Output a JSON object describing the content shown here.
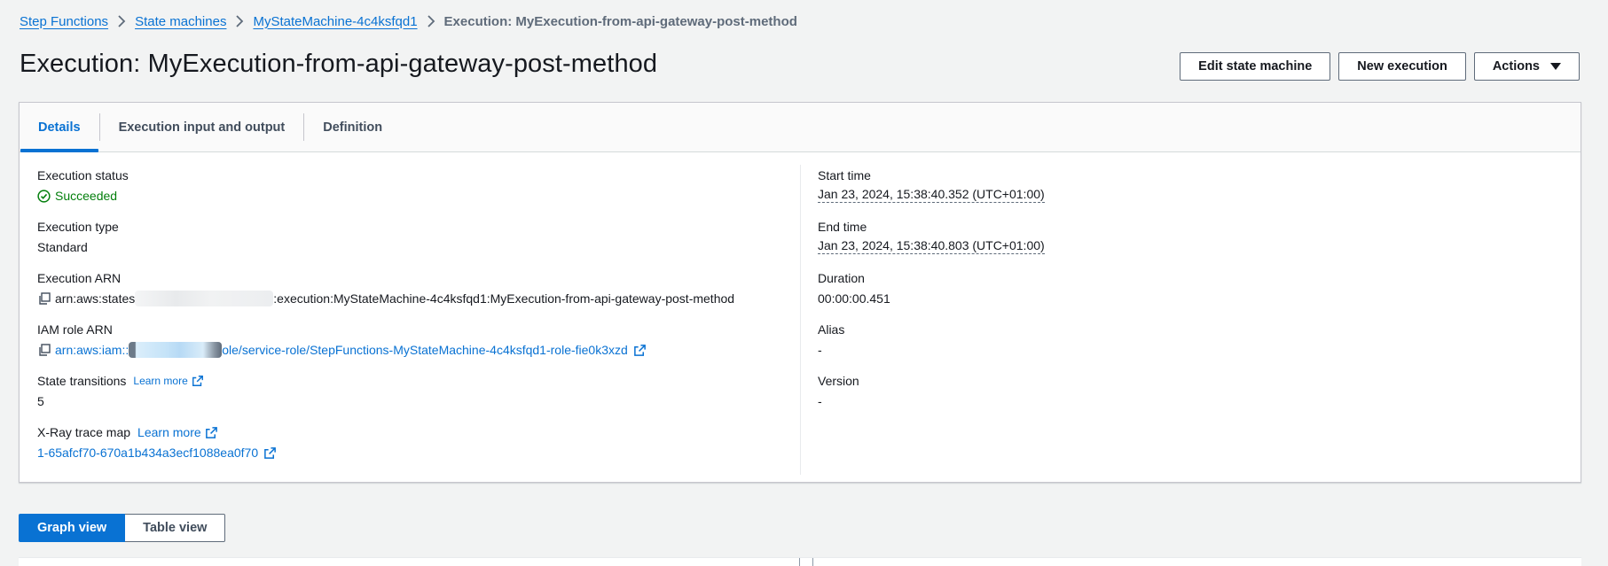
{
  "breadcrumb": {
    "items": [
      "Step Functions",
      "State machines",
      "MyStateMachine-4c4ksfqd1"
    ],
    "current": "Execution: MyExecution-from-api-gateway-post-method"
  },
  "page": {
    "title": "Execution: MyExecution-from-api-gateway-post-method"
  },
  "actions": {
    "edit_label": "Edit state machine",
    "new_execution_label": "New execution",
    "actions_label": "Actions"
  },
  "tabs": [
    "Details",
    "Execution input and output",
    "Definition"
  ],
  "details": {
    "execution_status": {
      "label": "Execution status",
      "value": "Succeeded"
    },
    "execution_type": {
      "label": "Execution type",
      "value": "Standard"
    },
    "execution_arn": {
      "label": "Execution ARN",
      "prefix": "arn:aws:states",
      "suffix": ":execution:MyStateMachine-4c4ksfqd1:MyExecution-from-api-gateway-post-method"
    },
    "iam_role_arn": {
      "label": "IAM role ARN",
      "prefix": "arn:aws:iam::",
      "suffix": "ole/service-role/StepFunctions-MyStateMachine-4c4ksfqd1-role-fie0k3xzd"
    },
    "state_transitions": {
      "label": "State transitions",
      "learn_more": "Learn more",
      "value": "5"
    },
    "xray": {
      "label": "X-Ray trace map",
      "learn_more": "Learn more",
      "value": "1-65afcf70-670a1b434a3ecf1088ea0f70"
    },
    "start_time": {
      "label": "Start time",
      "value": "Jan 23, 2024, 15:38:40.352 (UTC+01:00)"
    },
    "end_time": {
      "label": "End time",
      "value": "Jan 23, 2024, 15:38:40.803 (UTC+01:00)"
    },
    "duration": {
      "label": "Duration",
      "value": "00:00:00.451"
    },
    "alias": {
      "label": "Alias",
      "value": "-"
    },
    "version": {
      "label": "Version",
      "value": "-"
    }
  },
  "view_toggle": {
    "graph_label": "Graph view",
    "table_label": "Table view"
  },
  "colors": {
    "link": "#0972d3",
    "success": "#037f0c",
    "background": "#f2f3f3"
  }
}
